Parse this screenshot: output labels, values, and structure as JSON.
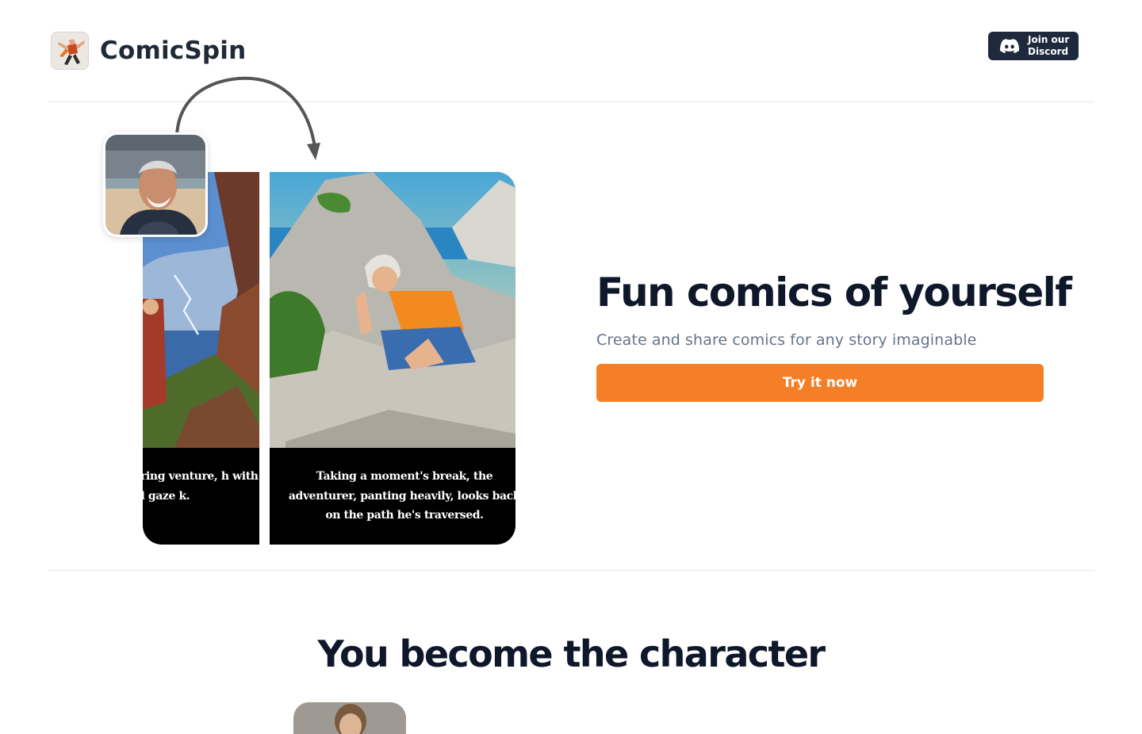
{
  "header": {
    "brand": "ComicSpin",
    "discord_label": "Join our Discord"
  },
  "hero": {
    "title": "Fun comics of yourself",
    "subtitle": "Create and share comics for any story imaginable",
    "cta_label": "Try it now",
    "captions": {
      "left": "e daring venture, h with a fixed gaze k.",
      "right": "Taking a moment's break, the adventurer, panting heavily, looks back on the path he's traversed."
    }
  },
  "section": {
    "title": "You become the character"
  },
  "colors": {
    "accent": "#f47f26",
    "dark_button": "#1e293b",
    "heading": "#0f172a",
    "muted": "#64748b"
  },
  "icons": [
    "logo-icon",
    "discord-icon",
    "curved-arrow-icon"
  ]
}
